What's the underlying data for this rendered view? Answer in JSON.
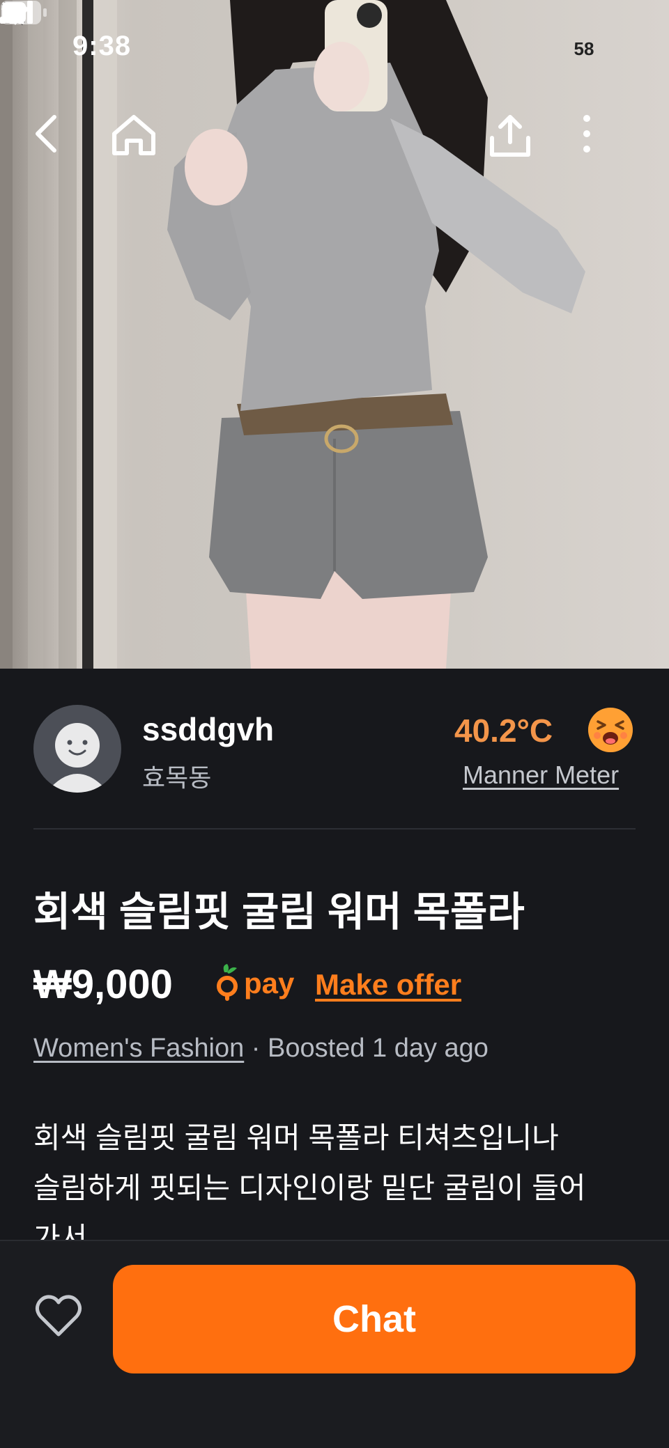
{
  "status_bar": {
    "time": "9:38",
    "battery": "58",
    "icons": [
      "bell-off-icon",
      "cellular-signal-icon",
      "wifi-icon",
      "battery-icon"
    ]
  },
  "nav": {
    "icons": [
      "back-chevron-icon",
      "home-icon",
      "share-icon",
      "more-vertical-icon"
    ]
  },
  "seller": {
    "name": "ssddgvh",
    "location": "효목동",
    "temperature": "40.2°C",
    "manner_label": "Manner Meter",
    "temp_face_icon": "laughing-face-icon"
  },
  "product": {
    "title": "회색 슬림핏 굴림 워머 목폴라",
    "price": "₩9,000",
    "pay_label": "pay",
    "make_offer": "Make offer",
    "category": "Women's Fashion",
    "meta_separator": " · ",
    "boosted": "Boosted 1 day ago",
    "description_lines": [
      "회색 슬림핏 굴림 워머 목폴라 티쳐츠입니나",
      "슬림하게 핏되는 디자인이랑 밑단 굴림이 들어",
      "가서"
    ]
  },
  "bottom_bar": {
    "chat_label": "Chat",
    "heart_icon": "heart-outline-icon"
  },
  "colors": {
    "background": "#17181c",
    "accent": "#ff6f0f",
    "temperature": "#f3954a"
  }
}
